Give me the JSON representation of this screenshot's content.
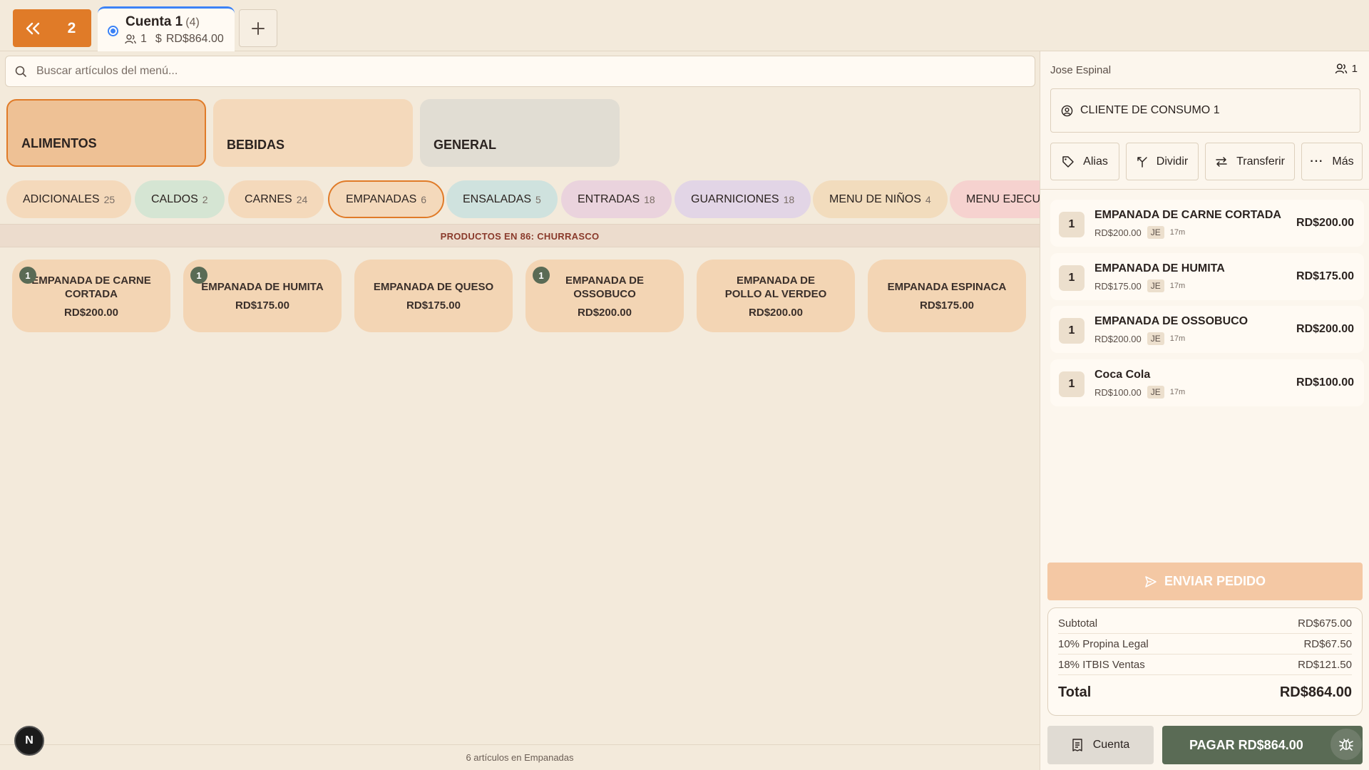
{
  "topbar": {
    "back_count": "2",
    "tab": {
      "title": "Cuenta 1",
      "count": "(4)",
      "guests": "1",
      "amount": "RD$864.00"
    }
  },
  "search": {
    "placeholder": "Buscar artículos del menú..."
  },
  "categories": [
    "ALIMENTOS",
    "BEBIDAS",
    "GENERAL"
  ],
  "subcategories": [
    {
      "label": "ADICIONALES",
      "count": "25",
      "color": "#f4d9bb"
    },
    {
      "label": "CALDOS",
      "count": "2",
      "color": "#d5e5d3"
    },
    {
      "label": "CARNES",
      "count": "24",
      "color": "#f4d9bb"
    },
    {
      "label": "EMPANADAS",
      "count": "6",
      "color": "#f4d9bb"
    },
    {
      "label": "ENSALADAS",
      "count": "5",
      "color": "#cfe2de"
    },
    {
      "label": "ENTRADAS",
      "count": "18",
      "color": "#ead3dd"
    },
    {
      "label": "GUARNICIONES",
      "count": "18",
      "color": "#e2d5e6"
    },
    {
      "label": "MENU DE NIÑOS",
      "count": "4",
      "color": "#f2dcbd"
    },
    {
      "label": "MENU EJECU",
      "count": "",
      "color": "#f6d2cf"
    }
  ],
  "banner": "PRODUCTOS EN 86: CHURRASCO",
  "products": [
    {
      "name": "EMPANADA DE CARNE CORTADA",
      "price": "RD$200.00",
      "qty": "1"
    },
    {
      "name": "EMPANADA DE HUMITA",
      "price": "RD$175.00",
      "qty": "1"
    },
    {
      "name": "EMPANADA DE QUESO",
      "price": "RD$175.00",
      "qty": ""
    },
    {
      "name": "EMPANADA DE OSSOBUCO",
      "price": "RD$200.00",
      "qty": "1"
    },
    {
      "name": "EMPANADA DE POLLO AL VERDEO",
      "price": "RD$200.00",
      "qty": ""
    },
    {
      "name": "EMPANADA ESPINACA",
      "price": "RD$175.00",
      "qty": ""
    }
  ],
  "footer": {
    "text": "6 artículos en Empanadas",
    "badge": "N"
  },
  "panel": {
    "waiter": "Jose Espinal",
    "guests": "1",
    "client": "CLIENTE DE CONSUMO 1",
    "actions": [
      "Alias",
      "Dividir",
      "Transferir",
      "Más"
    ],
    "orders": [
      {
        "qty": "1",
        "name": "EMPANADA DE CARNE CORTADA",
        "unit": "RD$200.00",
        "initials": "JE",
        "time": "17m",
        "total": "RD$200.00"
      },
      {
        "qty": "1",
        "name": "EMPANADA DE HUMITA",
        "unit": "RD$175.00",
        "initials": "JE",
        "time": "17m",
        "total": "RD$175.00"
      },
      {
        "qty": "1",
        "name": "EMPANADA DE OSSOBUCO",
        "unit": "RD$200.00",
        "initials": "JE",
        "time": "17m",
        "total": "RD$200.00"
      },
      {
        "qty": "1",
        "name": "Coca Cola",
        "unit": "RD$100.00",
        "initials": "JE",
        "time": "17m",
        "total": "RD$100.00"
      }
    ],
    "send_label": "ENVIAR PEDIDO",
    "totals": {
      "subtotal_label": "Subtotal",
      "subtotal": "RD$675.00",
      "tip_label": "10% Propina Legal",
      "tip": "RD$67.50",
      "tax_label": "18% ITBIS Ventas",
      "tax": "RD$121.50",
      "total_label": "Total",
      "total": "RD$864.00"
    },
    "bill_label": "Cuenta",
    "pay_label": "PAGAR RD$864.00"
  },
  "colors": {
    "accent": "#e07b28",
    "pay": "#5a6b55",
    "tab_active": "#3b82f6"
  }
}
